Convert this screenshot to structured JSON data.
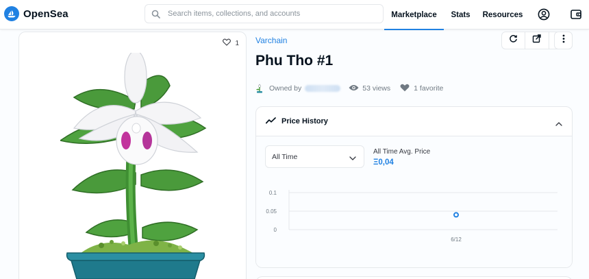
{
  "brand": {
    "name": "OpenSea",
    "accent": "#2081e2"
  },
  "search": {
    "placeholder": "Search items, collections, and accounts",
    "value": ""
  },
  "nav": {
    "marketplace": "Marketplace",
    "stats": "Stats",
    "resources": "Resources",
    "active": "Marketplace"
  },
  "icons": {
    "search": "search-icon",
    "profile": "user-circle-icon",
    "wallet": "wallet-icon",
    "heart": "heart-icon",
    "refresh": "refresh-icon",
    "external": "external-link-icon",
    "share": "share-icon",
    "more": "more-vertical-icon",
    "views": "eye-icon",
    "trend": "trend-line-icon",
    "collapse": "chevron-up-icon",
    "dropdown": "chevron-down-icon"
  },
  "asset": {
    "favorite_count": "1",
    "collection": "Varchain",
    "title": "Phu Tho #1",
    "owned_by_label": "Owned by",
    "views": "53 views",
    "favorites": "1 favorite"
  },
  "price_history": {
    "title": "Price History",
    "range_selected": "All Time",
    "avg_label": "All Time Avg. Price",
    "avg_value": "Ξ0,04"
  },
  "chart_data": {
    "type": "scatter",
    "title": "",
    "xlabel": "",
    "ylabel": "",
    "x": [
      "6/12"
    ],
    "values": [
      0.04
    ],
    "y_ticks": [
      "0.1",
      "0.05",
      "0"
    ],
    "ylim": [
      0,
      0.1
    ],
    "grid": true,
    "color": "#2081e2"
  }
}
